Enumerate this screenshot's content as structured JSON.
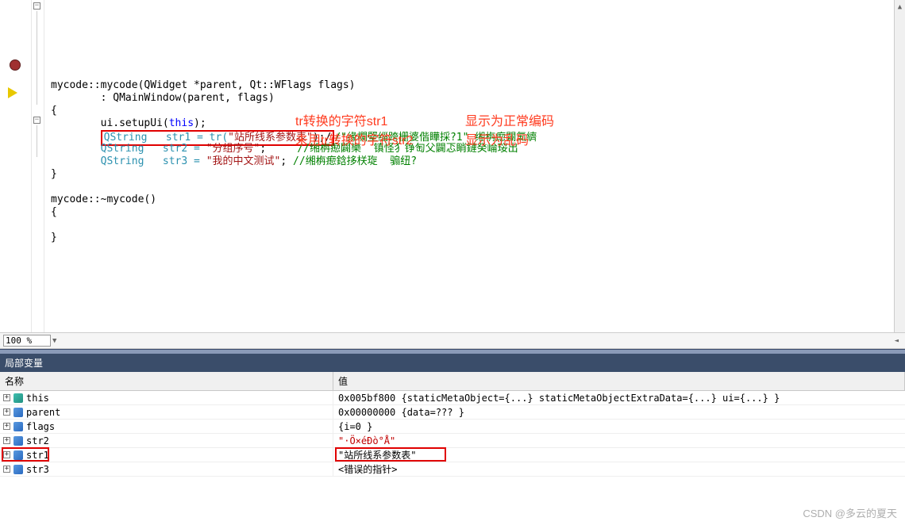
{
  "editor": {
    "zoom": "100 %",
    "lines": [
      {
        "indent": 0,
        "segs": [
          {
            "t": "",
            "c": ""
          },
          {
            "t": "mycode::mycode",
            "c": ""
          },
          {
            "t": "(QWidget *parent, Qt::WFlags flags)",
            "c": ""
          }
        ]
      },
      {
        "indent": 2,
        "segs": [
          {
            "t": ": QMainWindow(parent, flags)",
            "c": ""
          }
        ]
      },
      {
        "indent": 0,
        "segs": [
          {
            "t": "{",
            "c": ""
          }
        ]
      },
      {
        "indent": 2,
        "segs": [
          {
            "t": "ui.setupUi(",
            "c": ""
          },
          {
            "t": "this",
            "c": "kw"
          },
          {
            "t": ");",
            "c": ""
          }
        ]
      },
      {
        "indent": 2,
        "box": true,
        "segs": [
          {
            "t": "QString   str1 = tr(",
            "c": "type"
          },
          {
            "t": "\"站所线系参数表\"",
            "c": "str"
          },
          {
            "t": ");/",
            "c": ""
          }
        ],
        "trail": {
          "t": "/\"缘欄堅缁跨栅婆偕瞱採?1\" 缃栴瘛闢氭纃",
          "c": "cmt"
        }
      },
      {
        "indent": 2,
        "segs": [
          {
            "t": "QString   str2 = ",
            "c": "type"
          },
          {
            "t": "\"分组序号\"",
            "c": "str"
          },
          {
            "t": ";     ",
            "c": ""
          },
          {
            "t": "//缃栴瘛闢樂  镇怪犭铮匋父闢忑睄鏈癸崘珱出",
            "c": "cmt"
          }
        ]
      },
      {
        "indent": 2,
        "segs": [
          {
            "t": "QString   str3 = ",
            "c": "type"
          },
          {
            "t": "\"我的中文测试\"",
            "c": "str"
          },
          {
            "t": "; ",
            "c": ""
          },
          {
            "t": "//缃栴瘛鋡拸栚琁  骟纽?",
            "c": "cmt"
          }
        ]
      },
      {
        "indent": 0,
        "segs": [
          {
            "t": "}",
            "c": ""
          }
        ]
      },
      {
        "indent": 0,
        "segs": [
          {
            "t": "",
            "c": ""
          }
        ]
      },
      {
        "indent": 0,
        "segs": [
          {
            "t": "mycode::~mycode()",
            "c": ""
          }
        ]
      },
      {
        "indent": 0,
        "segs": [
          {
            "t": "{",
            "c": ""
          }
        ]
      },
      {
        "indent": 0,
        "segs": [
          {
            "t": "",
            "c": ""
          }
        ]
      },
      {
        "indent": 0,
        "segs": [
          {
            "t": "}",
            "c": ""
          }
        ]
      }
    ],
    "annotations": {
      "l1": "tr转换的字符str1",
      "l1b": "显示为正常编码",
      "l2": "未用tr转换的字符str2",
      "l2b": "显示为乱码"
    }
  },
  "varsPanel": {
    "title": "局部变量",
    "cols": {
      "name": "名称",
      "value": "值"
    },
    "rows": [
      {
        "icon": "teal",
        "name": "this",
        "value": "0x005bf800 {staticMetaObject={...} staticMetaObjectExtraData={...} ui={...} }",
        "red": false
      },
      {
        "icon": "blue",
        "name": "parent",
        "value": "0x00000000 {data=??? }",
        "red": false
      },
      {
        "icon": "blue",
        "name": "flags",
        "value": "{i=0 }",
        "red": false
      },
      {
        "icon": "blue",
        "name": "str2",
        "value": "\"·Ö×éÐò°Å\"",
        "red": true
      },
      {
        "icon": "blue",
        "name": "str1",
        "value": "\"站所线系参数表\"",
        "red": false,
        "highlightName": true,
        "highlightValue": true
      },
      {
        "icon": "blue",
        "name": "str3",
        "value": "<错误的指针>",
        "red": false
      }
    ]
  },
  "watermark": "CSDN @多云的夏天"
}
